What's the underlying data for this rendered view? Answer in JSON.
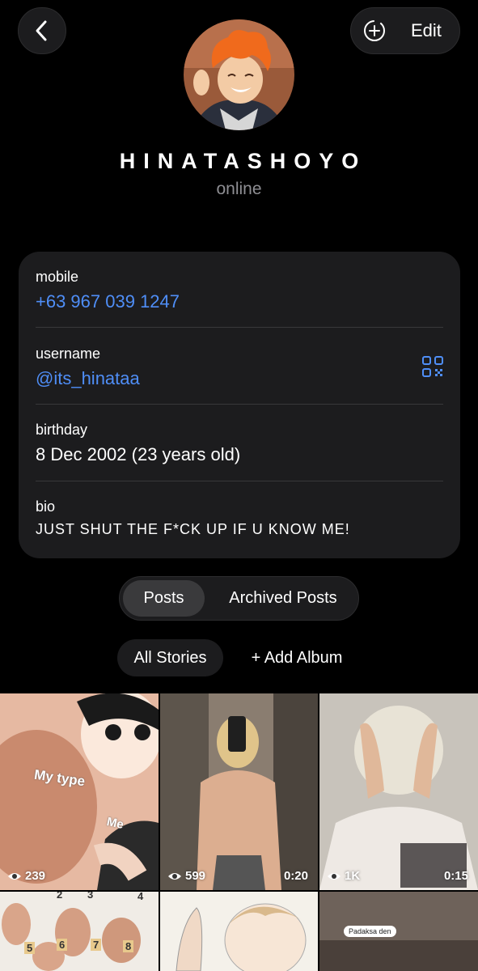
{
  "header": {
    "edit_label": "Edit"
  },
  "profile": {
    "name": "HINATASHOYO",
    "status": "online"
  },
  "info": {
    "mobile_label": "mobile",
    "mobile_value": "+63 967 039 1247",
    "username_label": "username",
    "username_value": "@its_hinataa",
    "birthday_label": "birthday",
    "birthday_value": "8 Dec 2002 (23 years old)",
    "bio_label": "bio",
    "bio_value": "JUST SHUT THE F*CK UP IF U KNOW ME!"
  },
  "tabs": {
    "posts": "Posts",
    "archived": "Archived Posts"
  },
  "filters": {
    "all_stories": "All Stories",
    "add_album": "+ Add Album"
  },
  "grid": [
    {
      "views": "239",
      "duration": "",
      "caption_1": "My type",
      "caption_2": "Me"
    },
    {
      "views": "599",
      "duration": "0:20"
    },
    {
      "views": "1K",
      "duration": "0:15"
    },
    {
      "views": "",
      "duration": "",
      "numbers": [
        "2",
        "3",
        "4",
        "5",
        "6",
        "7",
        "8"
      ]
    },
    {
      "views": "",
      "duration": ""
    },
    {
      "views": "",
      "duration": "",
      "caption": "Padaksa den"
    }
  ],
  "colors": {
    "accent": "#4f8ef7",
    "card": "#1c1c1e",
    "background": "#000000",
    "secondary_text": "#8e8e93"
  }
}
